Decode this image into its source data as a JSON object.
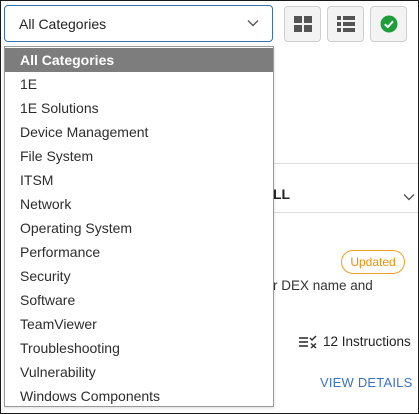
{
  "category_select": {
    "value": "All Categories",
    "options": [
      "All Categories",
      "1E",
      "1E Solutions",
      "Device Management",
      "File System",
      "ITSM",
      "Network",
      "Operating System",
      "Performance",
      "Security",
      "Software",
      "TeamViewer",
      "Troubleshooting",
      "Vulnerability",
      "Windows Components"
    ],
    "selected_index": 0
  },
  "toolbar": {
    "grid_view_icon": "grid-icon",
    "list_view_icon": "list-icon",
    "check_icon": "check-circle-icon"
  },
  "card": {
    "dropdown_text": "LL",
    "badge": "Updated",
    "description_fragment": "r DEX name and",
    "instructions_label": "12 Instructions",
    "view_details": "VIEW DETAILS"
  },
  "colors": {
    "accent_blue": "#3a72c4",
    "selected_item_bg": "#7d7d7d",
    "badge_orange": "#f0a020",
    "check_green": "#1e9e3a"
  }
}
